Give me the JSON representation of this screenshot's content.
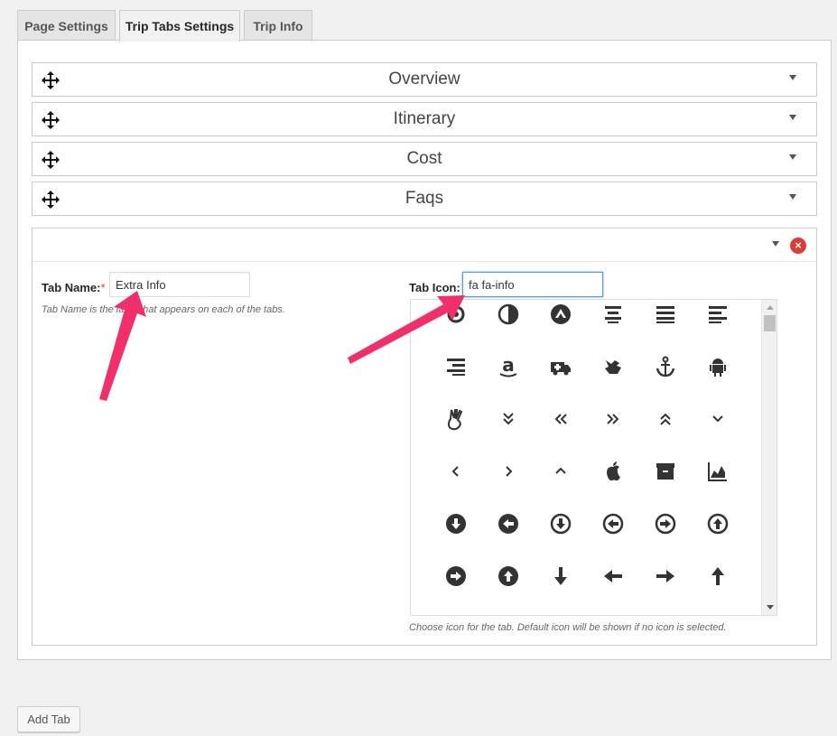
{
  "tabs": [
    {
      "label": "Page Settings"
    },
    {
      "label": "Trip Tabs Settings"
    },
    {
      "label": "Trip Info"
    }
  ],
  "accordion": [
    {
      "label": "Overview"
    },
    {
      "label": "Itinerary"
    },
    {
      "label": "Cost"
    },
    {
      "label": "Faqs"
    }
  ],
  "editor": {
    "tab_name_label": "Tab Name:",
    "required_mark": "*",
    "tab_name_value": "Extra Info",
    "tab_name_desc": "Tab Name is the label that appears on each of the tabs.",
    "tab_icon_label": "Tab Icon:",
    "tab_icon_value": "fa fa-info",
    "tab_icon_desc": "Choose icon for the tab. Default icon will be shown if no icon is selected."
  },
  "icons": [
    "500px-icon",
    "adjust-icon",
    "adn-icon",
    "align-center-icon",
    "align-justify-icon",
    "align-left-icon",
    "align-right-icon",
    "amazon-icon",
    "ambulance-icon",
    "sign-language-icon",
    "anchor-icon",
    "android-icon",
    "angellist-icon",
    "angle-double-down-icon",
    "angle-double-left-icon",
    "angle-double-right-icon",
    "angle-double-up-icon",
    "angle-down-icon",
    "angle-left-icon",
    "angle-right-icon",
    "angle-up-icon",
    "apple-icon",
    "archive-icon",
    "area-chart-icon",
    "arrow-circle-down-icon",
    "arrow-circle-left-icon",
    "arrow-circle-o-down-icon",
    "arrow-circle-o-left-icon",
    "arrow-circle-o-right-icon",
    "arrow-circle-o-up-icon",
    "arrow-circle-right-icon",
    "arrow-circle-up-icon",
    "arrow-down-icon",
    "arrow-left-icon",
    "arrow-right-icon",
    "arrow-up-icon"
  ],
  "add_tab_label": "Add Tab",
  "colors": {
    "annotation_arrow": "#f0306a",
    "close": "#dd3d36",
    "focus": "#5b9dd9"
  }
}
